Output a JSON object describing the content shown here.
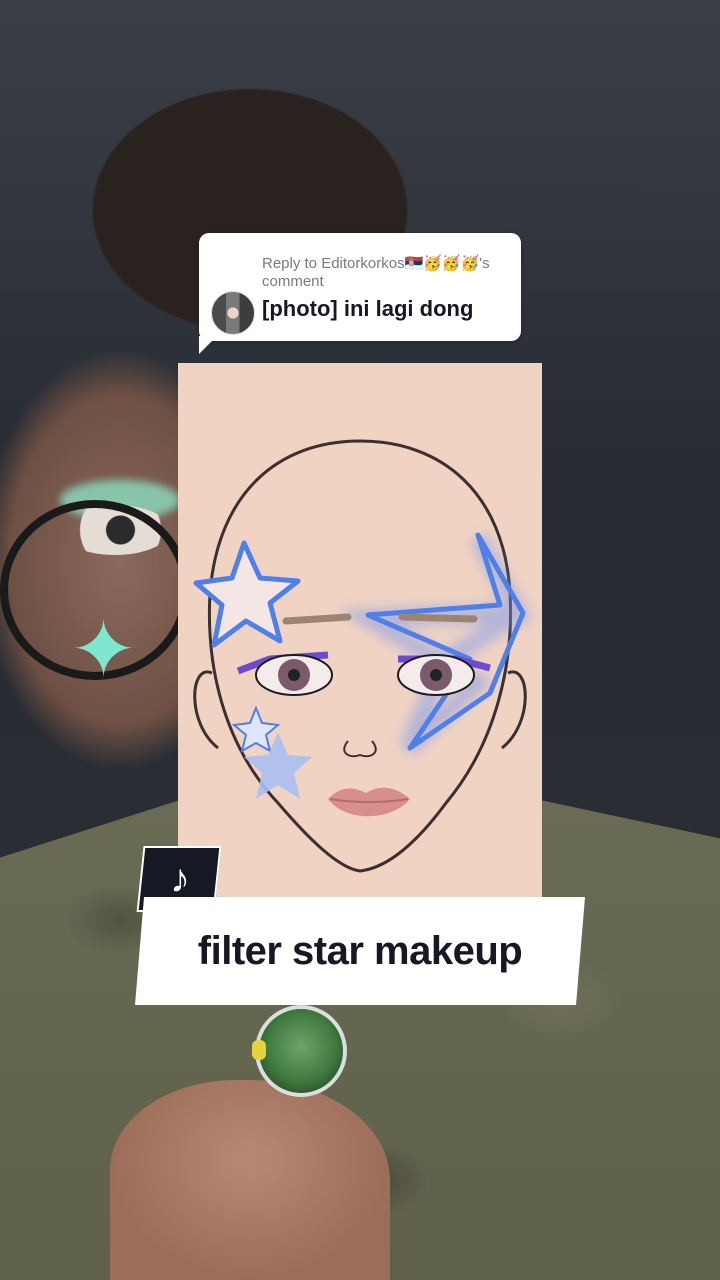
{
  "reply": {
    "meta": "Reply to Editorkorkos🇷🇸🥳🥳🥳's comment",
    "text": "[photo] ini lagi dong"
  },
  "caption": {
    "text": "filter star makeup"
  },
  "icons": {
    "app_logo": "tiktok-note-icon",
    "app_logo_glyph": "♪"
  },
  "colors": {
    "caption_bg": "#ffffff",
    "caption_text": "#161823",
    "badge_bg": "#161823",
    "star_blue": "#4f7fe8",
    "card_bg": "#f0d3c3"
  }
}
